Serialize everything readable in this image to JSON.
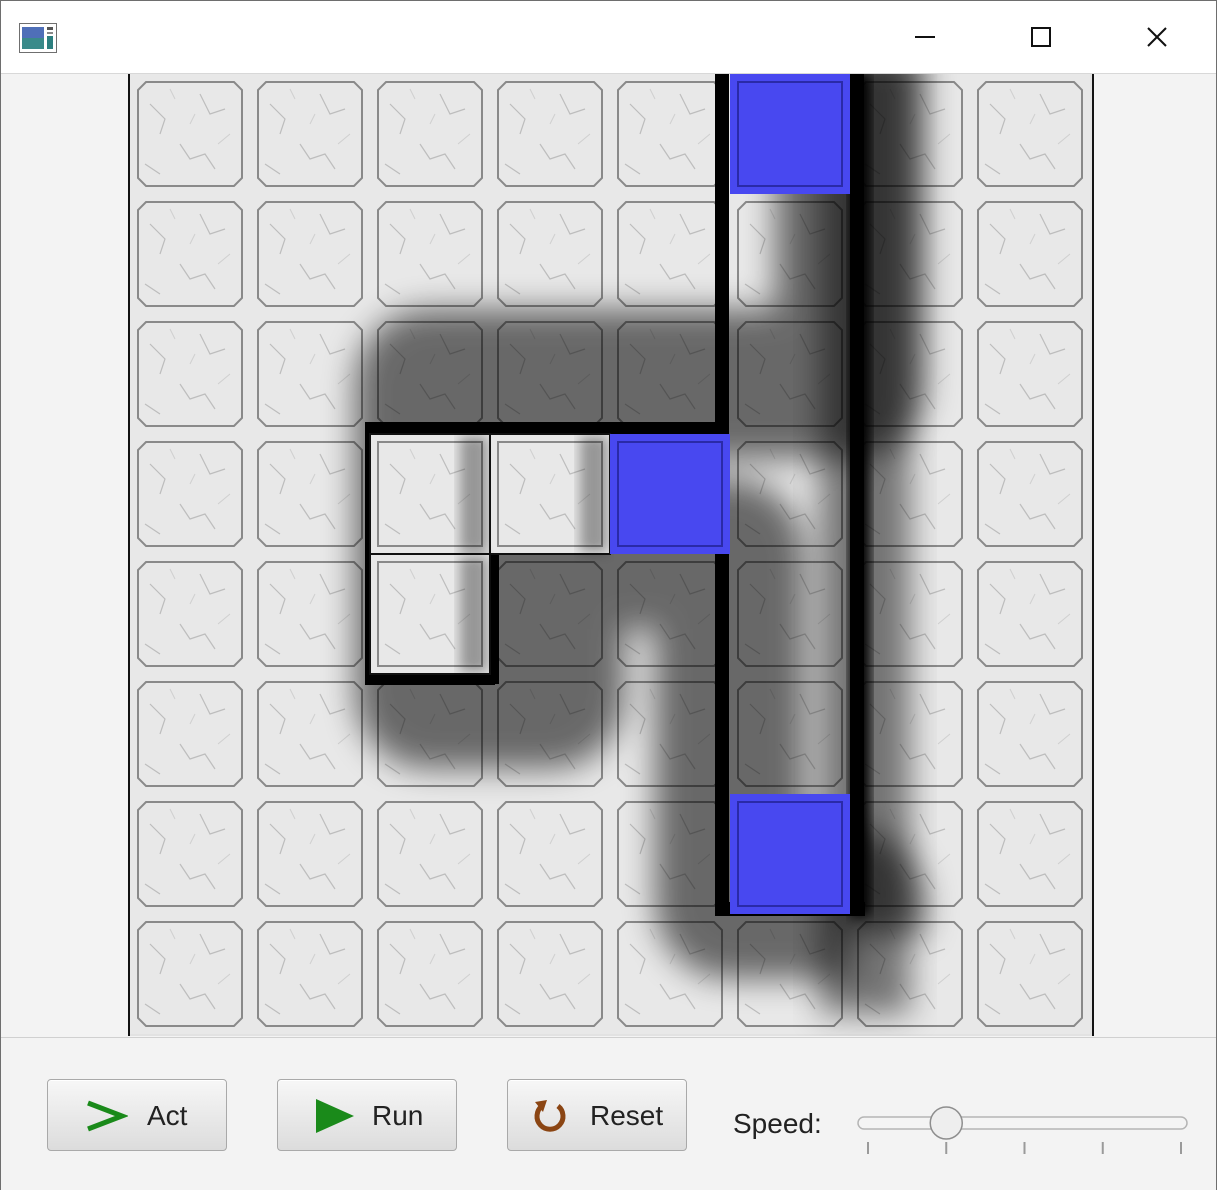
{
  "window": {
    "controls": {
      "minimize_icon": "minimize-icon",
      "maximize_icon": "maximize-icon",
      "close_icon": "close-icon"
    }
  },
  "world": {
    "columns": 8,
    "rows": 8,
    "blue_cells": [
      [
        5,
        0
      ],
      [
        4,
        3
      ],
      [
        5,
        6
      ]
    ],
    "raised_cells": [
      [
        2,
        3
      ],
      [
        3,
        3
      ],
      [
        2,
        4
      ]
    ],
    "colors": {
      "tile": "#e6e6e6",
      "tile_border": "#8a8a8a",
      "blue": "#4848f0",
      "wall": "#000000"
    }
  },
  "controls": {
    "act_label": "Act",
    "run_label": "Run",
    "reset_label": "Reset",
    "speed_label": "Speed:",
    "act_icon": "chevron-right-icon",
    "run_icon": "play-icon",
    "reset_icon": "reset-icon",
    "speed_value": 0.25,
    "colors": {
      "act_icon": "#1a8a1a",
      "run_icon": "#1a8a1a",
      "reset_icon": "#8b4513"
    }
  }
}
